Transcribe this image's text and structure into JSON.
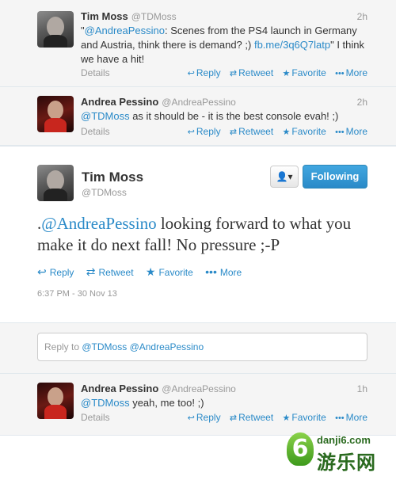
{
  "tweet1": {
    "name": "Tim Moss",
    "handle": "@TDMoss",
    "time": "2h",
    "mention": "@AndreaPessino",
    "text_a": ": Scenes from the PS4 launch in Germany and Austria, think there is demand? ;) ",
    "url": "fb.me/3q6Q7latp",
    "text_b": "\" I think we have a hit!",
    "quote_open": "\"",
    "details": "Details",
    "reply": "Reply",
    "retweet": "Retweet",
    "favorite": "Favorite",
    "more": "More"
  },
  "tweet2": {
    "name": "Andrea Pessino",
    "handle": "@AndreaPessino",
    "time": "2h",
    "mention": "@TDMoss",
    "text": " as it should be - it is the best console evah! ;)",
    "details": "Details",
    "reply": "Reply",
    "retweet": "Retweet",
    "favorite": "Favorite",
    "more": "More"
  },
  "main": {
    "name": "Tim Moss",
    "handle": "@TDMoss",
    "follow": "Following",
    "user_menu_icon": "person-icon",
    "text_prefix": ".",
    "mention": "@AndreaPessino",
    "text": " looking forward to what you make it do next fall! No pressure ;-P",
    "reply": "Reply",
    "retweet": "Retweet",
    "favorite": "Favorite",
    "more": "More",
    "timestamp": "6:37 PM - 30 Nov 13"
  },
  "reply_box": {
    "prefix": "Reply to ",
    "to1": "@TDMoss",
    "to2": "@AndreaPessino"
  },
  "tweet3": {
    "name": "Andrea Pessino",
    "handle": "@AndreaPessino",
    "time": "1h",
    "mention": "@TDMoss",
    "text": " yeah, me too! ;)",
    "details": "Details",
    "reply": "Reply",
    "retweet": "Retweet",
    "favorite": "Favorite",
    "more": "More"
  },
  "watermark": {
    "url": "danji6.com",
    "cn": "游乐网"
  },
  "colors": {
    "link": "#2a8ac8",
    "follow_button": "#2a8ac8",
    "watermark": "#2a6a1f"
  }
}
